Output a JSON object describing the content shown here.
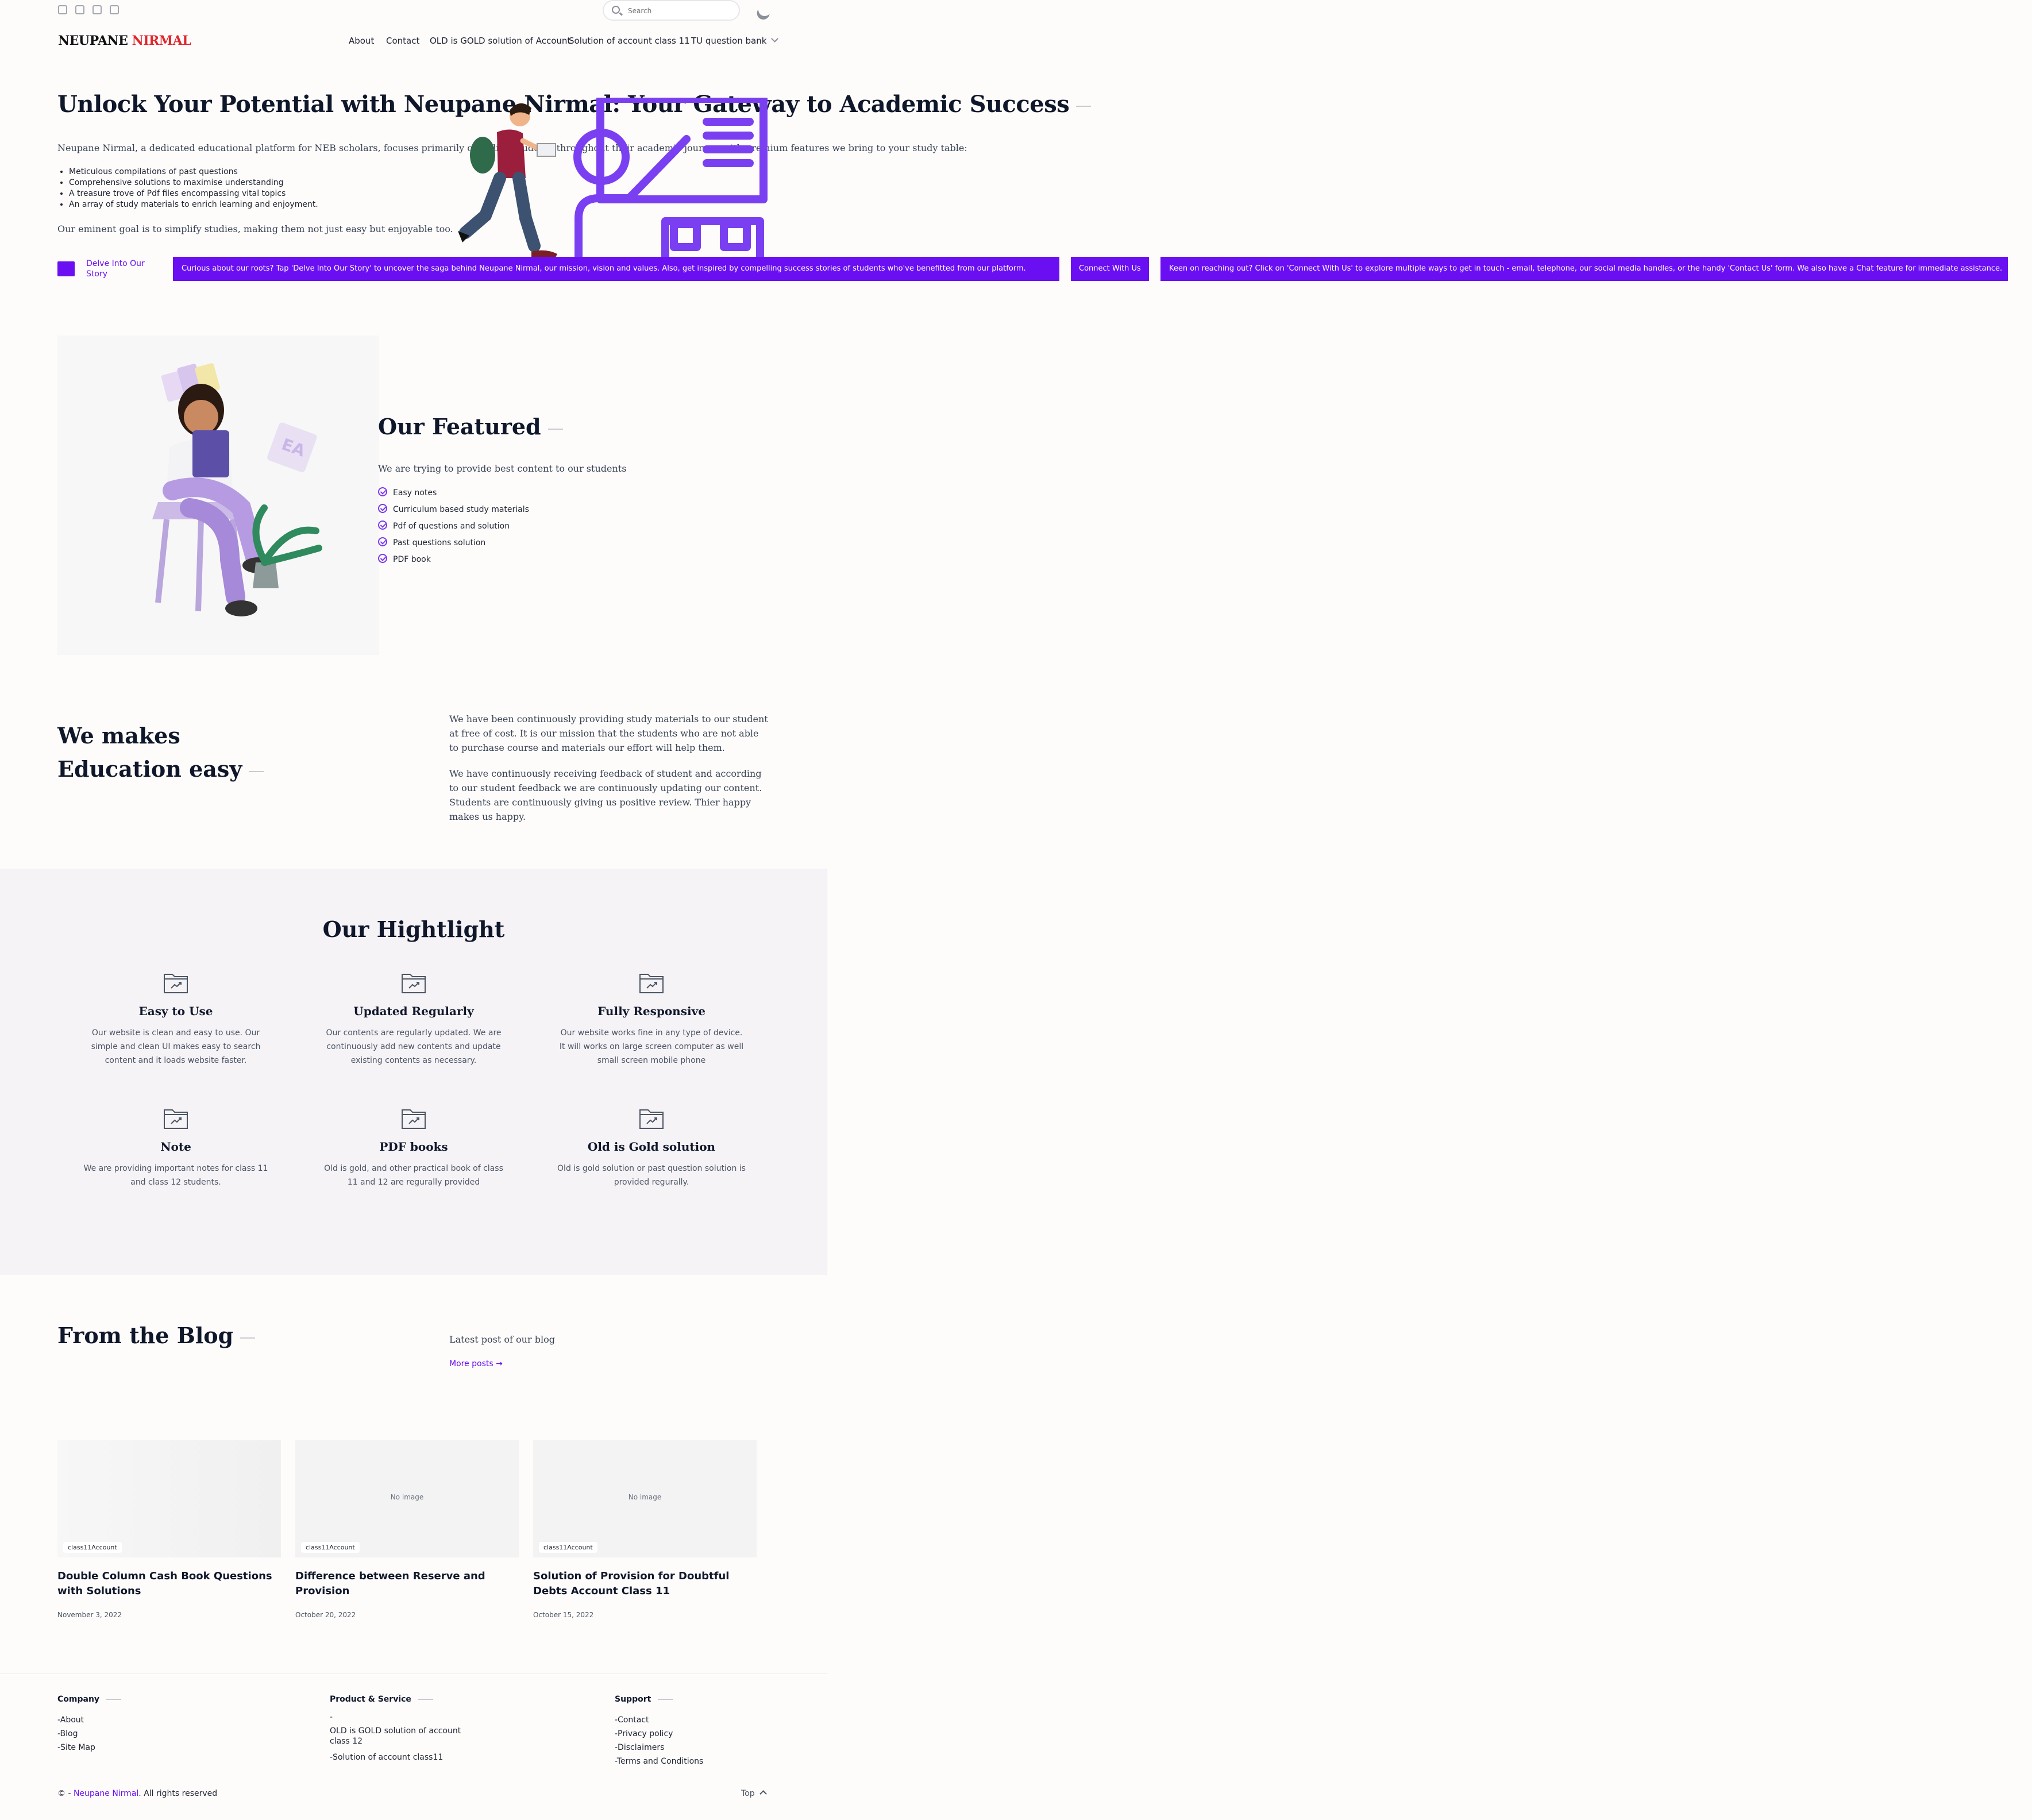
{
  "topbar": {
    "social_icons": [
      "facebook-icon",
      "instagram-icon",
      "twitter-icon",
      "linkedin-icon"
    ],
    "search_placeholder": "Search",
    "theme_icon": "moon-icon"
  },
  "header": {
    "logo_first": "NEUPANE",
    "logo_second": "NIRMAL",
    "nav": [
      "About",
      "Contact",
      "OLD is GOLD solution of Account",
      "Solution of account class 11",
      "TU question bank"
    ]
  },
  "hero": {
    "title": "Unlock Your Potential with Neupane Nirmal: Your Gateway to Academic Success",
    "intro": "Neupane Nirmal, a dedicated educational platform for NEB scholars, focuses primarily on aiding students throughout their academic journey with premium features we bring to your study table:",
    "bullets": [
      "Meticulous compilations of past questions",
      "Comprehensive solutions to maximise understanding",
      "A treasure trove of Pdf files encompassing vital topics",
      "An array of study materials to enrich learning and enjoyment."
    ],
    "goal": "Our eminent goal is to simplify studies, making them not just easy but enjoyable too.",
    "delve_label": "Delve Into Our Story",
    "banner_story": "Curious about our roots? Tap 'Delve Into Our Story' to uncover the saga behind Neupane Nirmal, our mission, vision and values. Also, get inspired by compelling success stories of students who've benefitted from our platform.",
    "connect_label": "Connect With Us",
    "banner_connect": "Keen on reaching out? Click on 'Connect With Us' to explore multiple ways to get in touch - email, telephone, our social media handles, or the handy 'Contact Us' form. We also have a Chat feature for immediate assistance."
  },
  "featured": {
    "title": "Our Featured",
    "subtitle": "We are trying to provide best content to our students",
    "items": [
      "Easy notes",
      "Curriculum based study materials",
      "Pdf of questions and solution",
      "Past questions solution",
      "PDF book"
    ]
  },
  "about": {
    "title_line1": "We makes",
    "title_line2": "Education easy",
    "p1": "We have been continuously providing study materials to our student at free of cost. It is our mission that the students who are not able to purchase course and materials our effort will help them.",
    "p2": "We have continuously receiving feedback of student and according to our student feedback we are continuously updating our content. Students are continuously giving us positive review. Thier happy makes us happy."
  },
  "highlight": {
    "title": "Our Hightlight",
    "cards": [
      {
        "title": "Easy to Use",
        "text": "Our website is clean and easy to use. Our simple and clean UI makes easy to search content and it loads website faster."
      },
      {
        "title": "Updated Regularly",
        "text": "Our contents are regularly updated. We are continuously add new contents and update existing contents as necessary."
      },
      {
        "title": "Fully Responsive",
        "text": "Our website works fine in any type of device. It will works on large screen computer as well small screen mobile phone"
      },
      {
        "title": "Note",
        "text": "We are providing important notes for class 11 and class 12 students."
      },
      {
        "title": "PDF books",
        "text": "Old is gold, and other practical book of class 11 and 12 are regurally provided"
      },
      {
        "title": "Old is Gold solution",
        "text": "Old is gold solution or past question solution is provided regurally."
      }
    ]
  },
  "blog": {
    "title": "From the Blog",
    "subtitle": "Latest post of our blog",
    "more_label": "More posts",
    "no_image": "No image",
    "posts": [
      {
        "tag": "class11Account",
        "title": "Double Column Cash Book Questions with Solutions",
        "date": "November 3, 2022"
      },
      {
        "tag": "class11Account",
        "title": "Difference between Reserve and Provision",
        "date": "October 20, 2022"
      },
      {
        "tag": "class11Account",
        "title": "Solution of Provision for Doubtful Debts Account Class 11",
        "date": "October 15, 2022"
      }
    ]
  },
  "footer": {
    "company": {
      "heading": "Company",
      "links": [
        "-About",
        "-Blog",
        "-Site Map"
      ]
    },
    "product": {
      "heading": "Product & Service",
      "links": [
        "-",
        "OLD is GOLD solution of account class 12",
        "-Solution of account class11"
      ]
    },
    "support": {
      "heading": "Support",
      "links": [
        "-Contact",
        "-Privacy policy",
        "-Disclaimers",
        "-Terms and Conditions"
      ]
    },
    "copyright_prefix": "© - ",
    "copyright_brand": "Neupane Nirmal",
    "copyright_suffix": ". All rights reserved",
    "top_label": "Top"
  },
  "colors": {
    "accent": "#6a0ff2",
    "logo_red": "#e1262c",
    "highlight_bg": "#f6f3f7"
  }
}
